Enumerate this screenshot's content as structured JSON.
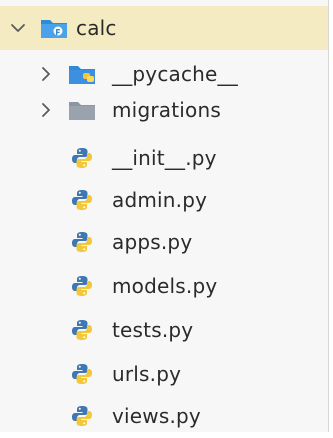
{
  "root": {
    "label": "calc",
    "expanded": true,
    "icon": "package-folder-icon",
    "accent": "#2f8bd8"
  },
  "items": [
    {
      "label": "__pycache__",
      "kind": "folder",
      "icon": "pycache-folder-icon",
      "collapsed": true
    },
    {
      "label": "migrations",
      "kind": "folder",
      "icon": "folder-icon",
      "collapsed": true
    },
    {
      "label": "__init__.py",
      "kind": "file",
      "icon": "python-file-icon"
    },
    {
      "label": "admin.py",
      "kind": "file",
      "icon": "python-file-icon"
    },
    {
      "label": "apps.py",
      "kind": "file",
      "icon": "python-file-icon"
    },
    {
      "label": "models.py",
      "kind": "file",
      "icon": "python-file-icon"
    },
    {
      "label": "tests.py",
      "kind": "file",
      "icon": "python-file-icon"
    },
    {
      "label": "urls.py",
      "kind": "file",
      "icon": "python-file-icon"
    },
    {
      "label": "views.py",
      "kind": "file",
      "icon": "python-file-icon"
    }
  ],
  "colors": {
    "selected_bg": "#f5ebc3",
    "folder_gray": "#9aa3ad",
    "python_blue": "#3d77b4",
    "python_yellow": "#f2c73a"
  }
}
